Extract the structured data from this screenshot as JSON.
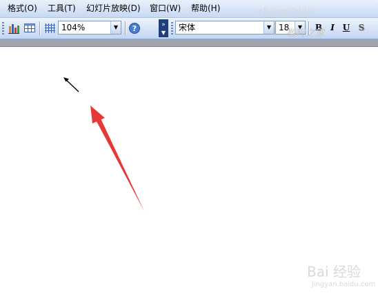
{
  "menu": {
    "items": [
      {
        "label": "格式(O)"
      },
      {
        "label": "工具(T)"
      },
      {
        "label": "幻灯片放映(D)"
      },
      {
        "label": "窗口(W)"
      },
      {
        "label": "帮助(H)"
      }
    ]
  },
  "toolbar": {
    "zoom_value": "104%",
    "font_name": "宋体",
    "font_size": "18",
    "bold_label": "B",
    "italic_label": "I",
    "underline_label": "U",
    "shadow_label": "S"
  },
  "watermark": {
    "site": "chengzhijia",
    "cn_text": "教程之家",
    "baidu": "Bai 经验",
    "baidu_url": "jingyan.baidu.com"
  },
  "colors": {
    "annotation_arrow": "#e53935",
    "cursor_arrow": "#000000"
  }
}
